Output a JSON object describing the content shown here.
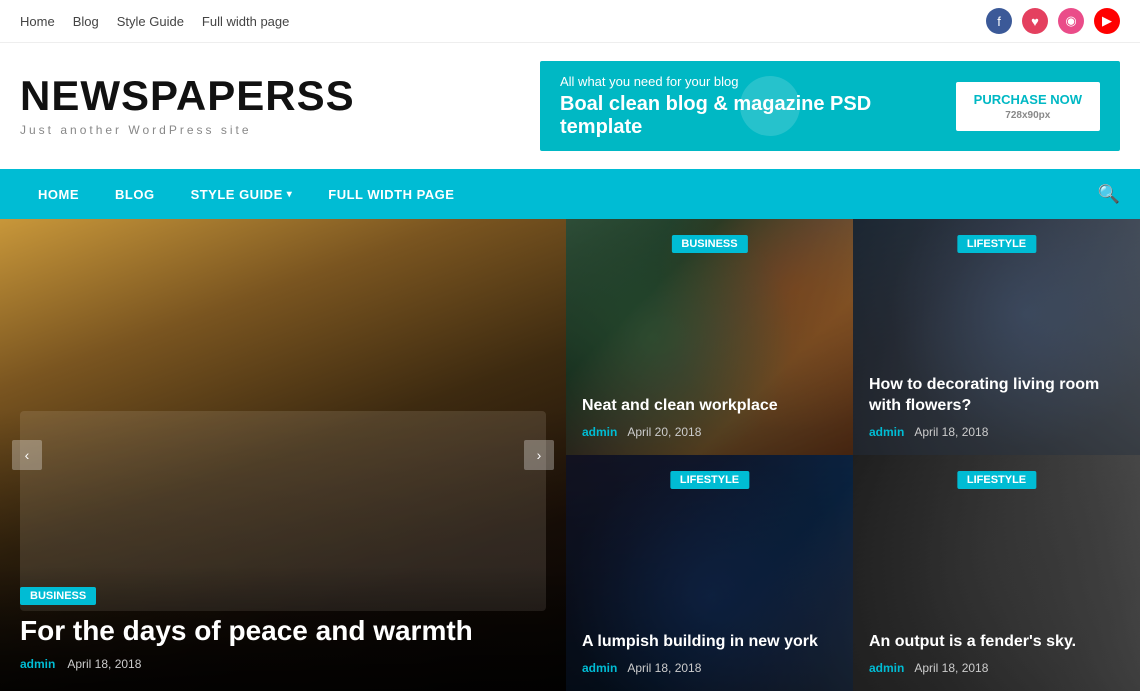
{
  "topNav": {
    "items": [
      {
        "label": "Home",
        "href": "#"
      },
      {
        "label": "Blog",
        "href": "#"
      },
      {
        "label": "Style Guide",
        "href": "#"
      },
      {
        "label": "Full width page",
        "href": "#"
      }
    ]
  },
  "social": {
    "facebook": "f",
    "instagram": "♥",
    "dribbble": "◉",
    "youtube": "▶"
  },
  "header": {
    "siteTitle": "NEWSPAPERSS",
    "siteSubtitle": "Just another WordPress site"
  },
  "banner": {
    "tagline": "All what you need for your blog",
    "mainText": "Boal clean blog & magazine PSD template",
    "buttonLabel": "PURCHASE NOW",
    "sizeLabel": "728x90px"
  },
  "mainNav": {
    "items": [
      {
        "label": "HOME",
        "hasDropdown": false
      },
      {
        "label": "BLOG",
        "hasDropdown": false
      },
      {
        "label": "STYLE GUIDE",
        "hasDropdown": true
      },
      {
        "label": "FULL WIDTH PAGE",
        "hasDropdown": false
      }
    ]
  },
  "heroMain": {
    "category": "BUSINESS",
    "title": "For the days of peace and warmth",
    "author": "admin",
    "date": "April 18, 2018"
  },
  "gridItems": [
    {
      "id": 1,
      "category": "BUSINESS",
      "title": "Neat and clean workplace",
      "author": "admin",
      "date": "April 20, 2018"
    },
    {
      "id": 2,
      "category": "LIFESTYLE",
      "title": "How to decorating living room with flowers?",
      "author": "admin",
      "date": "April 18, 2018"
    },
    {
      "id": 3,
      "category": "LIFESTYLE",
      "title": "A lumpish building in new york",
      "author": "admin",
      "date": "April 18, 2018"
    },
    {
      "id": 4,
      "category": "LIFESTYLE",
      "title": "An output is a fender's sky.",
      "author": "admin",
      "date": "April 18, 2018"
    }
  ],
  "colors": {
    "accent": "#00bcd4",
    "navBg": "#00bcd4"
  }
}
